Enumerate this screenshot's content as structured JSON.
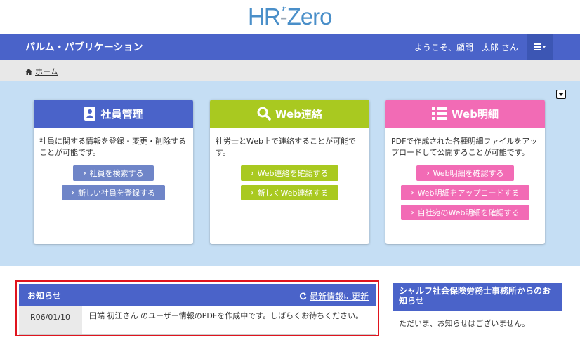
{
  "logo": {
    "text_hr": "HR",
    "text_dash": "-",
    "text_zero": "Zero"
  },
  "navbar": {
    "app_title": "パルム・パブリケーション",
    "welcome": "ようこそ、顧問　太郎 さん",
    "menu_icon": "hamburger-icon"
  },
  "breadcrumb": {
    "home": "ホーム"
  },
  "cards": [
    {
      "title": "社員管理",
      "color": "#4a63c9",
      "icon": "address-book-icon",
      "desc": "社員に関する情報を登録・変更・削除することが可能です。",
      "button_color": "#6f85c8",
      "buttons": [
        "社員を検索する",
        "新しい社員を登録する"
      ]
    },
    {
      "title": "Web連絡",
      "color": "#a9c920",
      "icon": "search-icon",
      "desc": "社労士とWeb上で連絡することが可能です。",
      "button_color": "#a9c920",
      "buttons": [
        "Web連絡を確認する",
        "新しくWeb連絡する"
      ]
    },
    {
      "title": "Web明細",
      "color": "#f26bb5",
      "icon": "list-icon",
      "desc": "PDFで作成された各種明細ファイルをアップロードして公開することが可能です。",
      "button_color": "#f26bb5",
      "buttons": [
        "Web明細を確認する",
        "Web明細をアップロードする",
        "自社宛のWeb明細を確認する"
      ]
    }
  ],
  "notice": {
    "title": "お知らせ",
    "refresh_label": "最新情報に更新",
    "items": [
      {
        "date": "R06/01/10",
        "message": "田端 初江さん のユーザー情報のPDFを作成中です。しばらくお待ちください。"
      }
    ]
  },
  "side_notice": {
    "title": "シャルフ社会保険労務士事務所からのお知らせ",
    "body": "ただいま、お知らせはございません。"
  },
  "colors": {
    "navy": "#4a63c9",
    "hero_bg": "#c5def4",
    "highlight_border": "#e0141e"
  }
}
